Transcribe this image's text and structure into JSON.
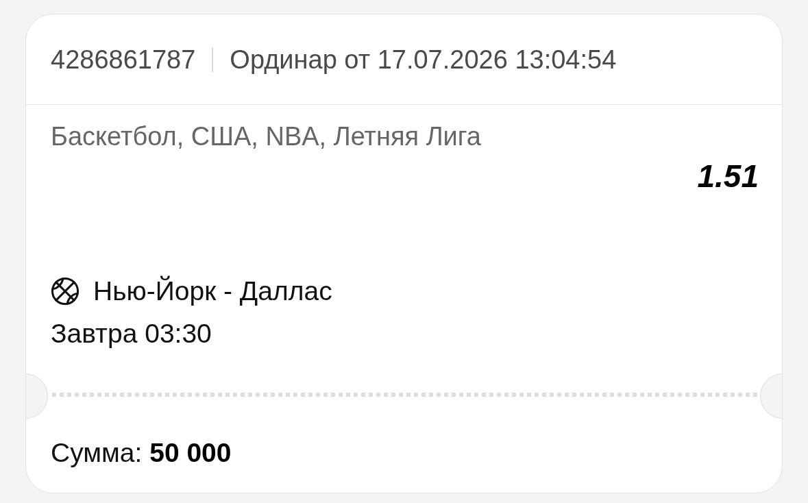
{
  "bet": {
    "number": "4286861787",
    "type_line": "Ординар от 17.07.2026 13:04:54"
  },
  "event": {
    "category": "Баскетбол, США, NBA, Летняя Лига",
    "odds": "1.51",
    "match": "Нью-Йорк - Даллас",
    "start": "Завтра 03:30"
  },
  "stake": {
    "text": "Сумма: **50 000**"
  }
}
